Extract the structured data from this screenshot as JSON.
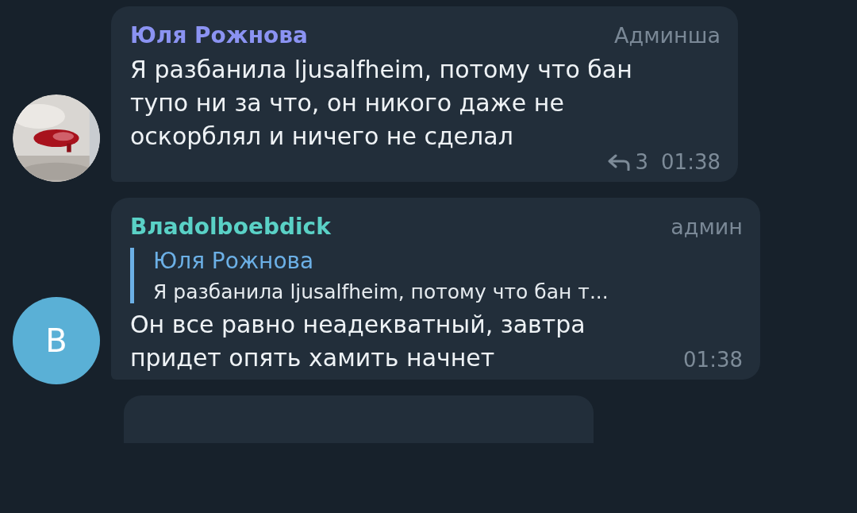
{
  "messages": [
    {
      "author": "Юля Рожнова",
      "color": "#8b93f2",
      "badge": "Админша",
      "text": "Я разбанила ljusalfheim, потому что бан тупо ни за что, он никого даже не оскорблял и ничего не сделал",
      "replies": "3",
      "time": "01:38"
    },
    {
      "author": "Влаdolboebdick",
      "color": "#5ad1c6",
      "badge": "админ",
      "avatar": {
        "kind": "letter",
        "letter": "B",
        "color": "#5ab0d6"
      },
      "quote": {
        "author": "Юля Рожнова",
        "text": "Я разбанила ljusalfheim, потому что бан т..."
      },
      "text": "Он все равно неадекватный, завтра придет опять хамить начнет",
      "time": "01:38"
    },
    {
      "avatar": {
        "kind": "none"
      }
    }
  ]
}
